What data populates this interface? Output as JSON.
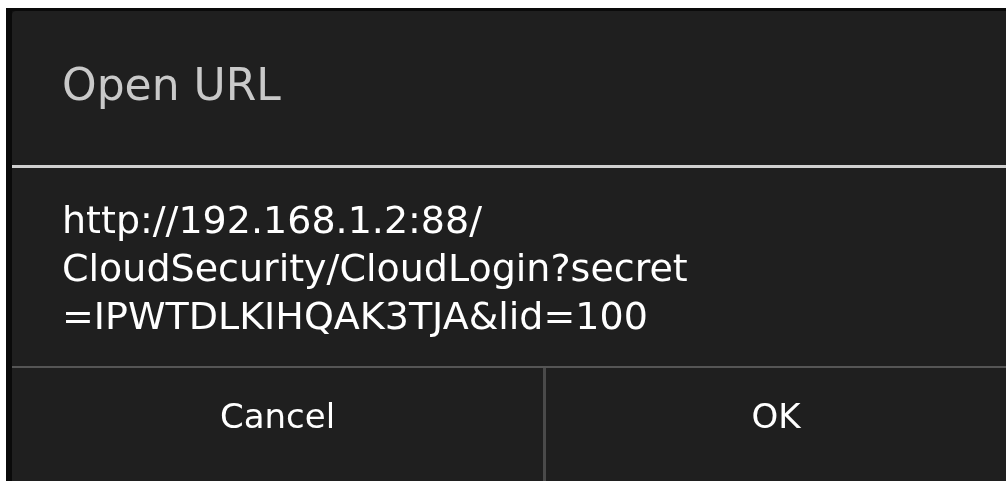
{
  "dialog": {
    "title": "Open URL",
    "message_lines": [
      "http://192.168.1.2:88/",
      "CloudSecurity/CloudLogin?secret",
      "=IPWTDLKIHQAK3TJA&lid=100"
    ],
    "buttons": [
      {
        "label": "Cancel"
      },
      {
        "label": "OK"
      }
    ]
  }
}
